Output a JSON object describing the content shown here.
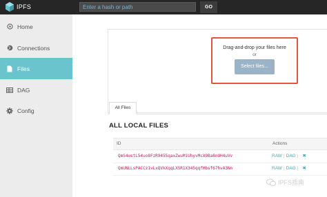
{
  "app": {
    "name": "IPFS"
  },
  "search": {
    "placeholder": "Enter a hash or path",
    "button": "GO"
  },
  "sidebar": {
    "items": [
      {
        "label": "Home",
        "icon": "home-icon"
      },
      {
        "label": "Connections",
        "icon": "globe-icon"
      },
      {
        "label": "Files",
        "icon": "file-icon",
        "active": true
      },
      {
        "label": "DAG",
        "icon": "table-icon"
      },
      {
        "label": "Config",
        "icon": "gear-icon"
      }
    ]
  },
  "upload": {
    "drop_text": "Drag-and-drop your files here",
    "or_text": "or",
    "select_button": "Select files..."
  },
  "tabs": [
    {
      "label": "All Files",
      "active": true
    }
  ],
  "section_title": "ALL LOCAL FILES",
  "table": {
    "columns": [
      "ID",
      "Actions"
    ],
    "rows": [
      {
        "id": "QmS4ustL54uo8FzR9455qaxZwuMiUhyvMcX9Ba8nUH4uVv",
        "actions": [
          "RAW",
          "DAG"
        ]
      },
      {
        "id": "QmUNLLsPACCz1vLxQVkXqqLX5R1X345qqfHbsf67hvA3Nn",
        "actions": [
          "RAW",
          "DAG"
        ]
      }
    ]
  },
  "watermark": {
    "text": "IPFS指南"
  },
  "colors": {
    "accent": "#69c4cd",
    "highlight": "#e2553d",
    "hash": "#c2185b",
    "link": "#4aa7b5"
  }
}
